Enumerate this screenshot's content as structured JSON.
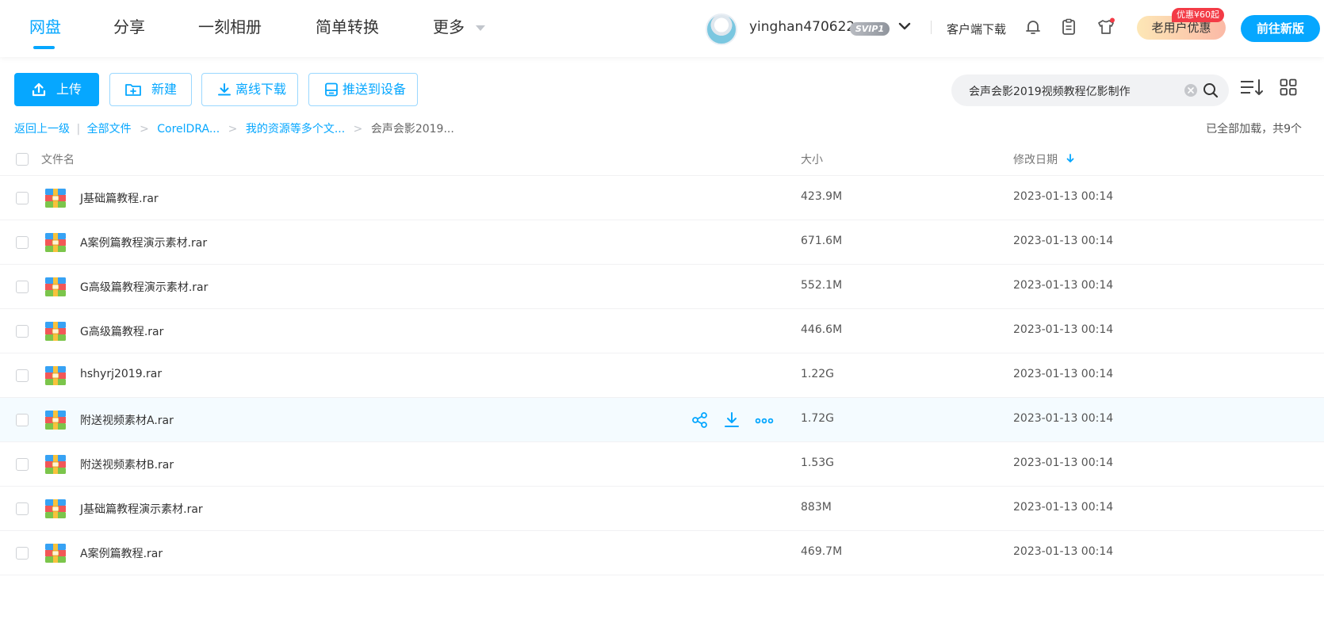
{
  "nav": {
    "tabs": [
      "网盘",
      "分享",
      "一刻相册",
      "简单转换",
      "更多"
    ],
    "active_index": 0,
    "username": "yinghan470622",
    "vip_badge": "SVIP1",
    "client_download": "客户端下载",
    "promo_badge": "优惠¥60起",
    "promo_label": "老用户优惠",
    "new_version": "前往新版"
  },
  "toolbar": {
    "upload": "上传",
    "new": "新建",
    "offline": "离线下载",
    "push": "推送到设备"
  },
  "search": {
    "value": "会声会影2019视频教程亿影制作"
  },
  "breadcrumb": {
    "back": "返回上一级",
    "divider": "|",
    "all_files": "全部文件",
    "level1": "CorelDRA...",
    "level2": "我的资源等多个文...",
    "current": "会声会影2019..."
  },
  "load_status": "已全部加载，共9个",
  "table": {
    "col_name": "文件名",
    "col_size": "大小",
    "col_date": "修改日期",
    "sort": "date-desc",
    "hover_row": 5,
    "rows": [
      {
        "name": "J基础篇教程.rar",
        "size": "423.9M",
        "date": "2023-01-13 00:14"
      },
      {
        "name": "A案例篇教程演示素材.rar",
        "size": "671.6M",
        "date": "2023-01-13 00:14"
      },
      {
        "name": "G高级篇教程演示素材.rar",
        "size": "552.1M",
        "date": "2023-01-13 00:14"
      },
      {
        "name": "G高级篇教程.rar",
        "size": "446.6M",
        "date": "2023-01-13 00:14"
      },
      {
        "name": "hshyrj2019.rar",
        "size": "1.22G",
        "date": "2023-01-13 00:14"
      },
      {
        "name": "附送视频素材A.rar",
        "size": "1.72G",
        "date": "2023-01-13 00:14"
      },
      {
        "name": "附送视频素材B.rar",
        "size": "1.53G",
        "date": "2023-01-13 00:14"
      },
      {
        "name": "J基础篇教程演示素材.rar",
        "size": "883M",
        "date": "2023-01-13 00:14"
      },
      {
        "name": "A案例篇教程.rar",
        "size": "469.7M",
        "date": "2023-01-13 00:14"
      }
    ]
  },
  "icons": {
    "nav_more": "caret-down-icon",
    "user_menu": "chevron-down-icon",
    "notification": "bell-icon",
    "tasks": "clipboard-icon",
    "skin": "tshirt-icon",
    "upload": "upload-icon",
    "new": "folder-plus-icon",
    "offline": "download-icon",
    "push": "device-icon",
    "search": "search-icon",
    "clear": "clear-icon",
    "sort": "sort-icon",
    "grid": "grid-view-icon",
    "row_share": "share-icon",
    "row_download": "download-icon",
    "row_more": "more-icon",
    "file_type": "rar-archive-icon"
  },
  "colors": {
    "accent": "#06a7ff",
    "promo_badge": "#f33b46",
    "hover_row": "#f4fbff"
  }
}
